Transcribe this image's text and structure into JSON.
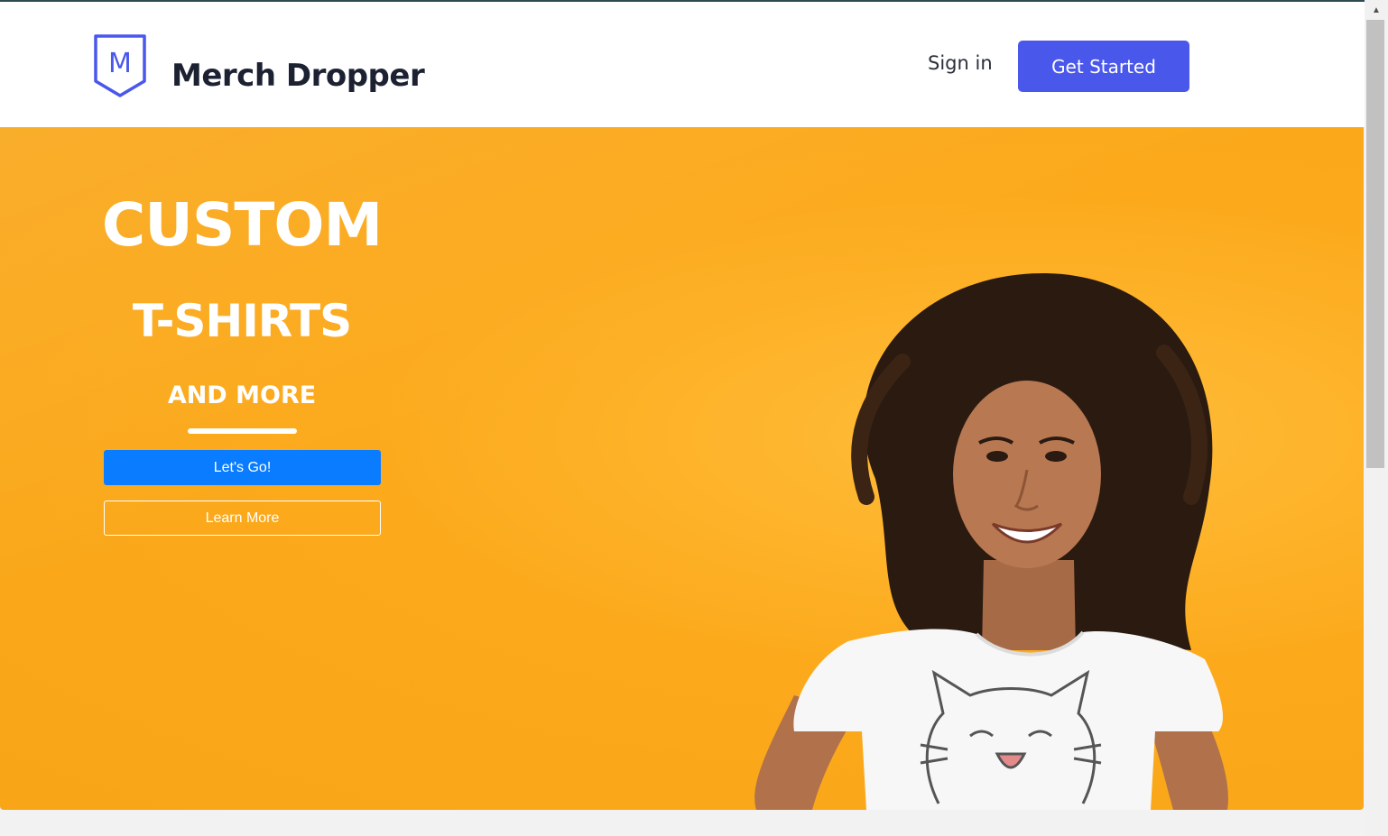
{
  "brand": {
    "logo_letter": "M",
    "name": "Merch Dropper",
    "accent_color": "#4a57eb"
  },
  "nav": {
    "sign_in": "Sign in",
    "get_started": "Get Started"
  },
  "hero": {
    "headline_1": "CUSTOM",
    "headline_2": "T-SHIRTS",
    "headline_3": "AND MORE",
    "primary_button": "Let's Go!",
    "secondary_button": "Learn More",
    "background_color": "#fcaa1c",
    "primary_button_color": "#0a7cff",
    "image": "smiling-woman-in-white-cat-tshirt"
  },
  "scrollbar": {
    "up_arrow_icon": "triangle-up-icon"
  }
}
